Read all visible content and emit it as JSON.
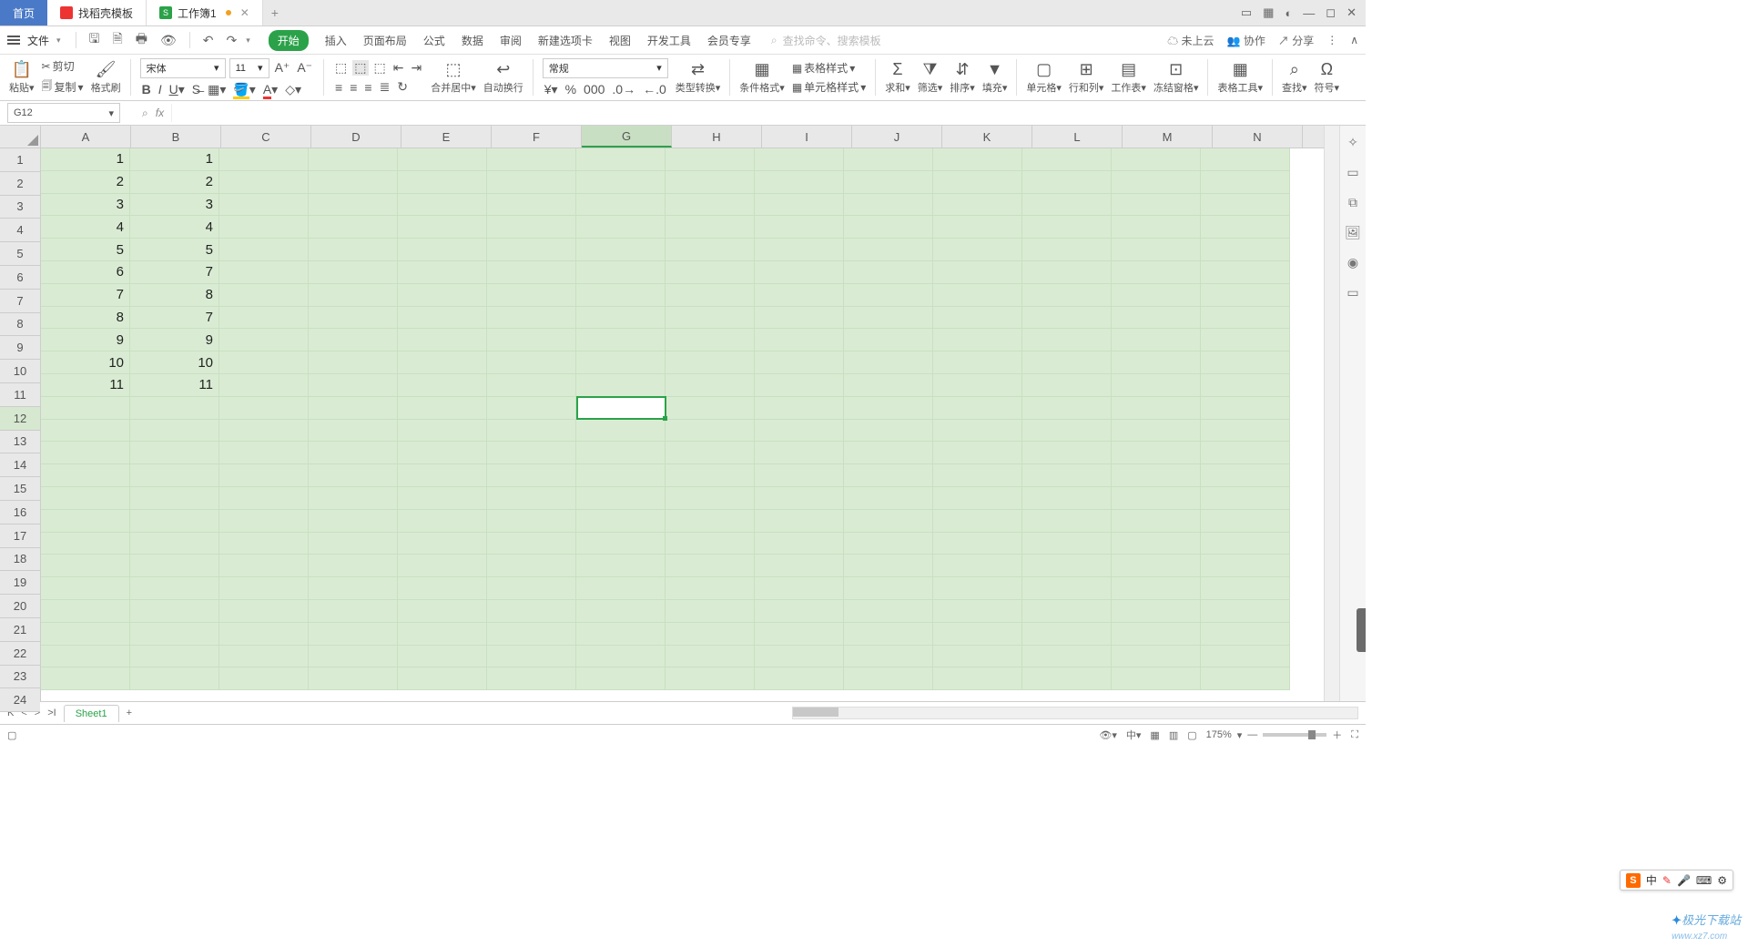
{
  "tabs": {
    "home": "首页",
    "template": "找稻壳模板",
    "doc": "工作簿1",
    "plus": "+"
  },
  "window_icons": [
    "▭",
    "▦",
    "◐",
    "—",
    "◻",
    "✕"
  ],
  "filebar": {
    "file_label": "文件",
    "menus": [
      "开始",
      "插入",
      "页面布局",
      "公式",
      "数据",
      "审阅",
      "新建选项卡",
      "视图",
      "开发工具",
      "会员专享"
    ],
    "active_menu": 0,
    "search_placeholder": "查找命令、搜索模板"
  },
  "file_right": {
    "cloud": "未上云",
    "collab": "协作",
    "share": "分享"
  },
  "ribbon": {
    "paste": "粘贴",
    "cut": "剪切",
    "copy": "复制",
    "fmtpainter": "格式刷",
    "font_name": "宋体",
    "font_size": "11",
    "merge": "合并居中",
    "wrap": "自动换行",
    "number_fmt": "常规",
    "type_conv": "类型转换",
    "cond_fmt": "条件格式",
    "cell_style": "单元格样式",
    "table_style": "表格样式",
    "sum": "求和",
    "filter": "筛选",
    "sort": "排序",
    "fill": "填充",
    "cell": "单元格",
    "rowcol": "行和列",
    "sheet": "工作表",
    "freeze": "冻结窗格",
    "tabletool": "表格工具",
    "find": "查找",
    "symbol": "符号"
  },
  "name_box": "G12",
  "fx_label": "fx",
  "columns": [
    "A",
    "B",
    "C",
    "D",
    "E",
    "F",
    "G",
    "H",
    "I",
    "J",
    "K",
    "L",
    "M",
    "N"
  ],
  "row_count": 24,
  "active_col_index": 6,
  "active_row_index": 11,
  "cell_data": {
    "A": [
      "1",
      "2",
      "3",
      "4",
      "5",
      "6",
      "7",
      "8",
      "9",
      "10",
      "11"
    ],
    "B": [
      "1",
      "2",
      "3",
      "4",
      "5",
      "7",
      "8",
      "7",
      "9",
      "10",
      "11"
    ]
  },
  "sheet": {
    "nav": [
      "K",
      "<",
      ">",
      ">I"
    ],
    "name": "Sheet1",
    "add": "+"
  },
  "status": {
    "zoom": "175%",
    "views": [
      "▦",
      "▥",
      "▢"
    ]
  },
  "ime": {
    "s": "S",
    "lang": "中",
    "items": [
      "✎",
      "☁",
      "⌨",
      "⚙"
    ]
  },
  "watermark_brand": "极光下载站",
  "watermark_url": "www.xz7.com"
}
